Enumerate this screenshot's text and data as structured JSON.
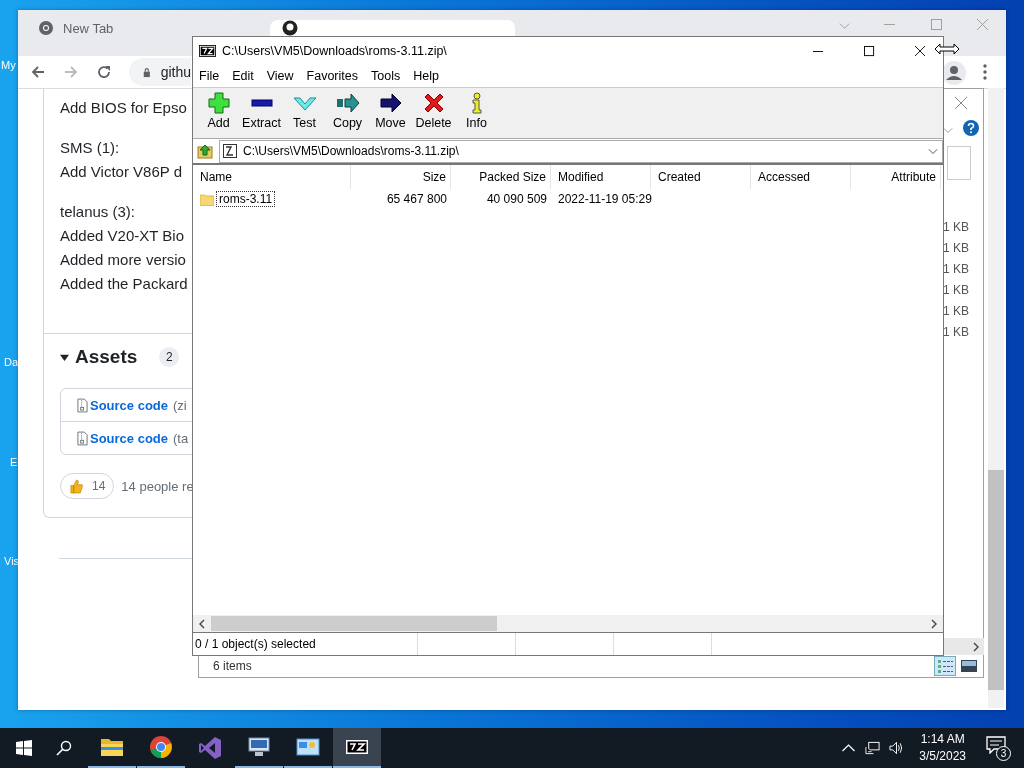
{
  "desktop": {
    "icons": [
      {
        "label": "My"
      },
      {
        "label": "Da"
      },
      {
        "label": "E"
      },
      {
        "label": "Vis"
      }
    ]
  },
  "browser": {
    "tabs": [
      {
        "label": "New Tab",
        "selected": false
      },
      {
        "selected": true
      }
    ],
    "address": "githu",
    "page": {
      "lines": [
        {
          "kind": "text",
          "text": "Add BIOS for Epso"
        },
        {
          "kind": "gap"
        },
        {
          "kind": "text",
          "text": "SMS (1):"
        },
        {
          "kind": "text",
          "text": "Add Victor V86P d"
        },
        {
          "kind": "gap"
        },
        {
          "kind": "text",
          "text": "telanus (3):"
        },
        {
          "kind": "text",
          "text": "Added V20-XT Bio"
        },
        {
          "kind": "text",
          "text": "Added more versio"
        },
        {
          "kind": "text",
          "text": "Added the Packard"
        }
      ],
      "assets": {
        "title": "Assets",
        "expanded": true,
        "count": "2",
        "items": [
          {
            "name": "Source code",
            "suffix": "(zi"
          },
          {
            "name": "Source code",
            "suffix": "(ta"
          }
        ]
      },
      "reaction": {
        "count": "14",
        "text": "14 people re"
      }
    }
  },
  "explorer": {
    "sizes": [
      "1 KB",
      "1 KB",
      "1 KB",
      "1 KB",
      "1 KB",
      "1 KB"
    ],
    "status": "6 items"
  },
  "sevenzip": {
    "title": "C:\\Users\\VM5\\Downloads\\roms-3.11.zip\\",
    "menu": [
      "File",
      "Edit",
      "View",
      "Favorites",
      "Tools",
      "Help"
    ],
    "toolbar": [
      {
        "kind": "add",
        "label": "Add"
      },
      {
        "kind": "extract",
        "label": "Extract"
      },
      {
        "kind": "test",
        "label": "Test"
      },
      {
        "kind": "copy",
        "label": "Copy"
      },
      {
        "kind": "move",
        "label": "Move"
      },
      {
        "kind": "delete",
        "label": "Delete"
      },
      {
        "kind": "info",
        "label": "Info"
      }
    ],
    "path": "C:\\Users\\VM5\\Downloads\\roms-3.11.zip\\",
    "columns": [
      {
        "label": "Name"
      },
      {
        "label": "Size"
      },
      {
        "label": "Packed Size"
      },
      {
        "label": "Modified"
      },
      {
        "label": "Created"
      },
      {
        "label": "Accessed"
      },
      {
        "label": "Attribute"
      }
    ],
    "rows": [
      {
        "cells": [
          "roms-3.11",
          "65 467 800",
          "40 090 509",
          "2022-11-19 05:29"
        ],
        "selected": false,
        "focused": true
      }
    ],
    "status": "0 / 1 object(s) selected"
  },
  "taskbar": {
    "apps": [
      {
        "kind": "folder",
        "running": true,
        "selected": false
      },
      {
        "kind": "chrome",
        "running": true,
        "selected": false
      },
      {
        "kind": "vs",
        "running": false,
        "selected": false
      },
      {
        "kind": "remote",
        "running": true,
        "selected": false
      },
      {
        "kind": "panel",
        "running": true,
        "selected": false
      },
      {
        "kind": "sevenzip",
        "running": true,
        "selected": true
      }
    ],
    "time": "1:14 AM",
    "date": "3/5/2023",
    "notifications": "3"
  }
}
